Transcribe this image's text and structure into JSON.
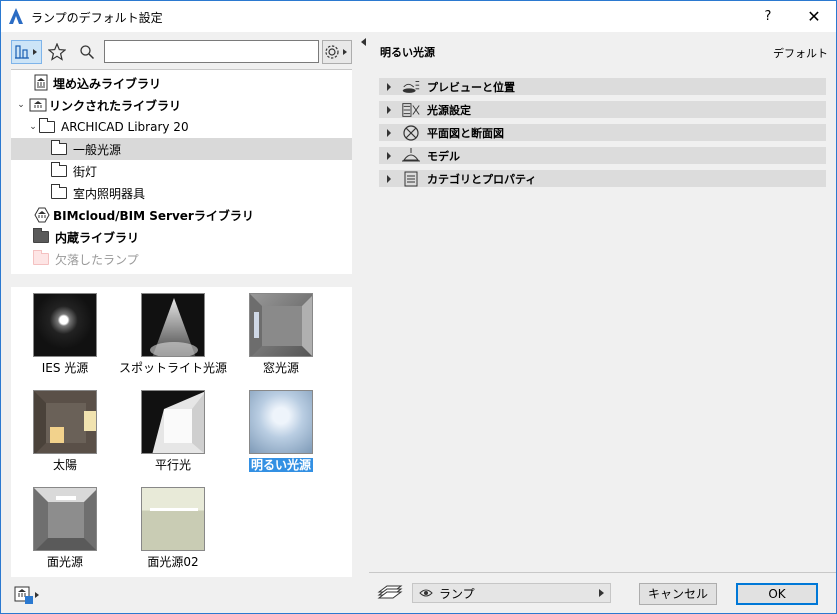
{
  "window": {
    "title": "ランプのデフォルト設定",
    "help": "?",
    "close": "✕"
  },
  "library_tree": [
    {
      "label": "埋め込みライブラリ",
      "icon": "library-icon",
      "bold": true
    },
    {
      "label": "リンクされたライブラリ",
      "icon": "library-icon",
      "bold": true,
      "expanded": true
    },
    {
      "label": "ARCHICAD Library 20",
      "icon": "folder-icon",
      "expanded": true
    },
    {
      "label": "一般光源",
      "icon": "folder-icon",
      "selected": true
    },
    {
      "label": "街灯",
      "icon": "folder-icon"
    },
    {
      "label": "室内照明器具",
      "icon": "folder-icon"
    },
    {
      "label": "BIMcloud/BIM Serverライブラリ",
      "icon": "bimcloud-icon",
      "bold": true
    },
    {
      "label": "内蔵ライブラリ",
      "icon": "folder-filled-icon",
      "bold": true
    },
    {
      "label": "欠落したランプ",
      "icon": "folder-missing-icon",
      "dim": true
    }
  ],
  "search": {
    "value": ""
  },
  "objects": [
    {
      "label": "IES 光源"
    },
    {
      "label": "スポットライト光源"
    },
    {
      "label": "窓光源"
    },
    {
      "label": "太陽"
    },
    {
      "label": "平行光"
    },
    {
      "label": "明るい光源",
      "selected": true
    },
    {
      "label": "面光源"
    },
    {
      "label": "面光源02"
    }
  ],
  "settings": {
    "object_name": "明るい光源",
    "default_label": "デフォルト",
    "sections": [
      {
        "label": "プレビューと位置",
        "icon": "preview-icon"
      },
      {
        "label": "光源設定",
        "icon": "light-settings-icon"
      },
      {
        "label": "平面図と断面図",
        "icon": "floorplan-icon"
      },
      {
        "label": "モデル",
        "icon": "model-icon"
      },
      {
        "label": "カテゴリとプロパティ",
        "icon": "properties-icon"
      }
    ]
  },
  "footer": {
    "layer_value": "ランプ",
    "cancel_label": "キャンセル",
    "ok_label": "OK"
  }
}
